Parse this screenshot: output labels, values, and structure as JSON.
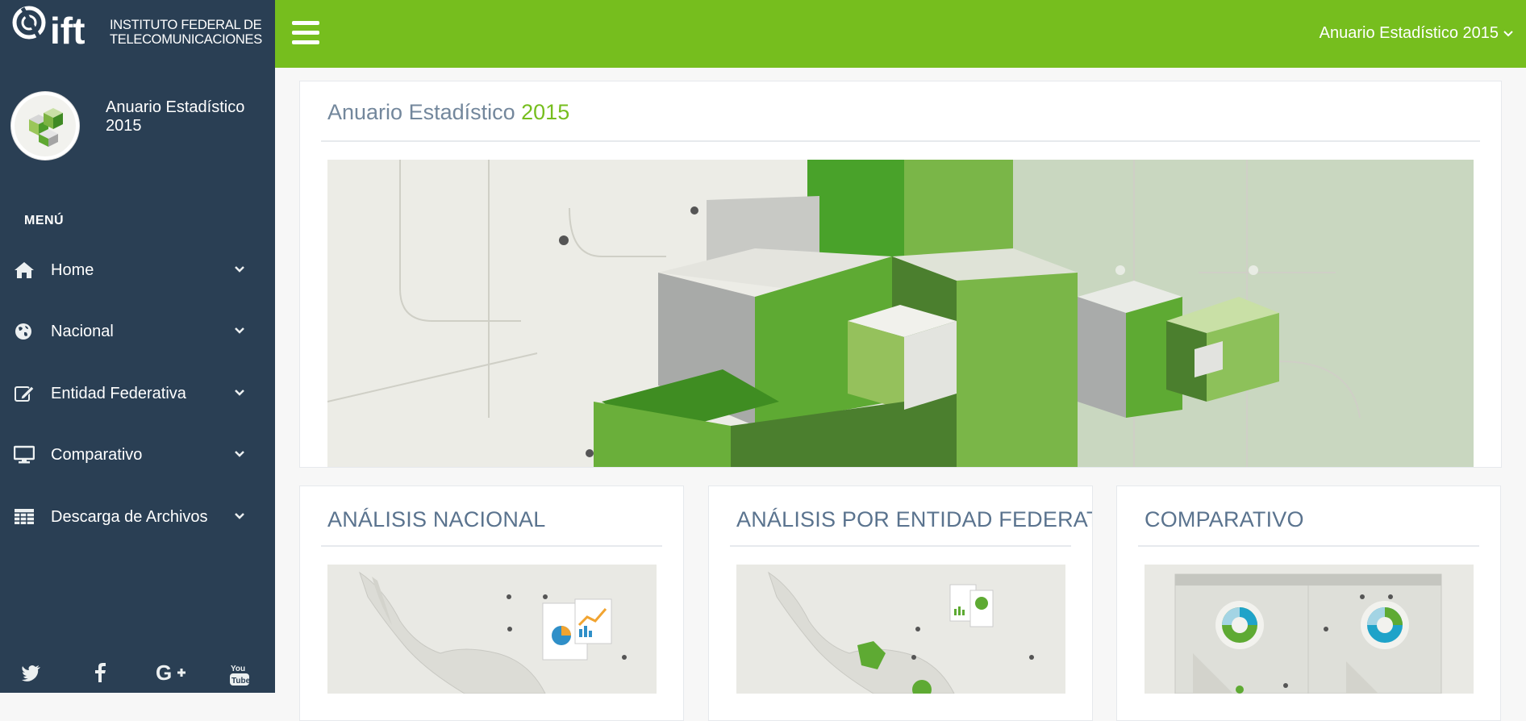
{
  "brand": {
    "logo_text": "ift",
    "org_line1": "INSTITUTO FEDERAL DE",
    "org_line2": "TELECOMUNICACIONES"
  },
  "profile": {
    "name": "Anuario Estadístico 2015"
  },
  "menu": {
    "heading": "MENÚ",
    "items": [
      {
        "label": "Home",
        "icon": "home-icon"
      },
      {
        "label": "Nacional",
        "icon": "globe-icon"
      },
      {
        "label": "Entidad Federativa",
        "icon": "edit-icon"
      },
      {
        "label": "Comparativo",
        "icon": "desktop-icon"
      },
      {
        "label": "Descarga de Archivos",
        "icon": "table-icon"
      }
    ]
  },
  "social": [
    "twitter-icon",
    "facebook-icon",
    "google-plus-icon",
    "youtube-icon"
  ],
  "topbar": {
    "title": "Anuario Estadístico 2015",
    "color": "#76be1e"
  },
  "hero": {
    "title_prefix": "Anuario Estadístico",
    "title_year": "2015"
  },
  "cards": [
    {
      "title": "ANÁLISIS NACIONAL"
    },
    {
      "title": "ANÁLISIS POR ENTIDAD FEDERATIVA"
    },
    {
      "title": "COMPARATIVO"
    }
  ],
  "colors": {
    "sidebar": "#2a3f54",
    "accent": "#76be1e",
    "title_gray": "#73879c"
  }
}
